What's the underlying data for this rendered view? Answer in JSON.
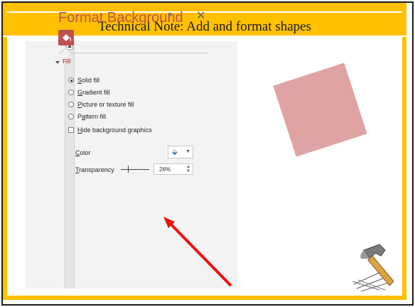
{
  "slide": {
    "title": "Technical Note: Add and format shapes"
  },
  "pane": {
    "title": "Format Background",
    "section": "Fill",
    "options": [
      {
        "label": "Solid fill",
        "selected": true,
        "underline": "S",
        "rest": "olid fill"
      },
      {
        "label": "Gradient fill",
        "selected": false,
        "underline": "G",
        "rest": "radient fill"
      },
      {
        "label": "Picture or texture fill",
        "selected": false,
        "underline": "P",
        "rest": "icture or texture fill"
      },
      {
        "label": "Pattern fill",
        "selected": false,
        "pre": "P",
        "underline": "a",
        "rest": "ttern fill"
      }
    ],
    "hide_background": {
      "pre": "",
      "underline": "H",
      "rest": "ide background graphics",
      "checked": false
    },
    "color_label": {
      "underline": "C",
      "rest": "olor"
    },
    "transparency_label": {
      "underline": "T",
      "rest": "ransparency"
    },
    "transparency_value": "26%",
    "transparency": 0.26
  },
  "colors": {
    "banner": "#ffc000",
    "accent": "#c0504d",
    "shape_fill": "#e0a3a3",
    "arrow": "#ee1111"
  },
  "icons": [
    "scroll-up-icon",
    "dropdown-icon",
    "close-icon",
    "paint-bucket-icon",
    "collapse-caret-icon",
    "hammer-icon"
  ]
}
